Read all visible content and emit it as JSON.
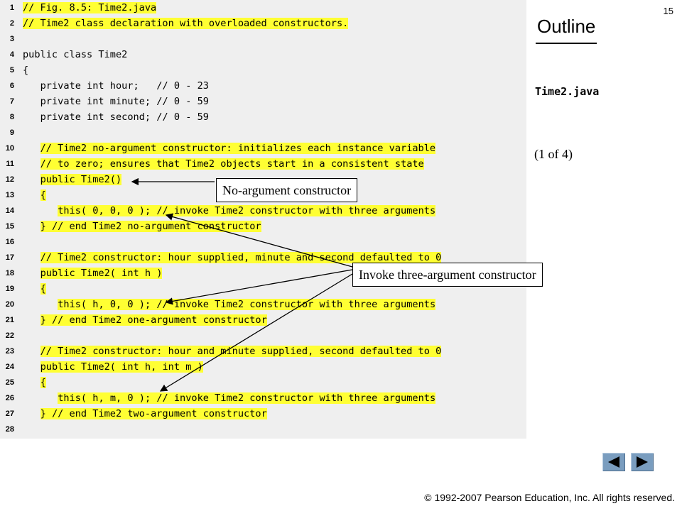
{
  "slide_number": "15",
  "outline": {
    "title": "Outline",
    "file_name": "Time2.java",
    "page_indicator": "(1 of 4)"
  },
  "callouts": {
    "no_arg": "No-argument constructor",
    "invoke_three": "Invoke three-argument constructor"
  },
  "copyright": "© 1992-2007 Pearson Education, Inc.  All rights reserved.",
  "nav": {
    "prev": "previous-slide",
    "next": "next-slide",
    "color": "#7a9dbf"
  },
  "highlight_color": "#ffff33",
  "code_lines": [
    {
      "n": "1",
      "text": "// Fig. 8.5: Time2.java",
      "indent": 0,
      "hl": true
    },
    {
      "n": "2",
      "text": "// Time2 class declaration with overloaded constructors.",
      "indent": 0,
      "hl": true
    },
    {
      "n": "3",
      "text": "",
      "indent": 0,
      "hl": false
    },
    {
      "n": "4",
      "text": "public class Time2",
      "indent": 0,
      "hl": false
    },
    {
      "n": "5",
      "text": "{",
      "indent": 0,
      "hl": false
    },
    {
      "n": "6",
      "text": "private int hour;   // 0 - 23",
      "indent": 3,
      "hl": false
    },
    {
      "n": "7",
      "text": "private int minute; // 0 - 59",
      "indent": 3,
      "hl": false
    },
    {
      "n": "8",
      "text": "private int second; // 0 - 59",
      "indent": 3,
      "hl": false
    },
    {
      "n": "9",
      "text": "",
      "indent": 0,
      "hl": false
    },
    {
      "n": "10",
      "text": "// Time2 no-argument constructor: initializes each instance variable",
      "indent": 3,
      "hl": true
    },
    {
      "n": "11",
      "text": "// to zero; ensures that Time2 objects start in a consistent state",
      "indent": 3,
      "hl": true
    },
    {
      "n": "12",
      "text": "public Time2()",
      "indent": 3,
      "hl": true
    },
    {
      "n": "13",
      "text": "{",
      "indent": 3,
      "hl": true
    },
    {
      "n": "14",
      "text": "this( 0, 0, 0 ); // invoke Time2 constructor with three arguments",
      "indent": 6,
      "hl": true
    },
    {
      "n": "15",
      "text": "} // end Time2 no-argument constructor",
      "indent": 3,
      "hl": true
    },
    {
      "n": "16",
      "text": "",
      "indent": 0,
      "hl": false
    },
    {
      "n": "17",
      "text": "// Time2 constructor: hour supplied, minute and second defaulted to 0",
      "indent": 3,
      "hl": true
    },
    {
      "n": "18",
      "text": "public Time2( int h )",
      "indent": 3,
      "hl": true
    },
    {
      "n": "19",
      "text": "{",
      "indent": 3,
      "hl": true
    },
    {
      "n": "20",
      "text": "this( h, 0, 0 ); // invoke Time2 constructor with three arguments",
      "indent": 6,
      "hl": true
    },
    {
      "n": "21",
      "text": "} // end Time2 one-argument constructor",
      "indent": 3,
      "hl": true
    },
    {
      "n": "22",
      "text": "",
      "indent": 0,
      "hl": false
    },
    {
      "n": "23",
      "text": "// Time2 constructor: hour and minute supplied, second defaulted to 0",
      "indent": 3,
      "hl": true
    },
    {
      "n": "24",
      "text": "public Time2( int h, int m )",
      "indent": 3,
      "hl": true
    },
    {
      "n": "25",
      "text": "{",
      "indent": 3,
      "hl": true
    },
    {
      "n": "26",
      "text": "this( h, m, 0 ); // invoke Time2 constructor with three arguments",
      "indent": 6,
      "hl": true
    },
    {
      "n": "27",
      "text": "} // end Time2 two-argument constructor",
      "indent": 3,
      "hl": true
    },
    {
      "n": "28",
      "text": "",
      "indent": 0,
      "hl": false
    }
  ]
}
